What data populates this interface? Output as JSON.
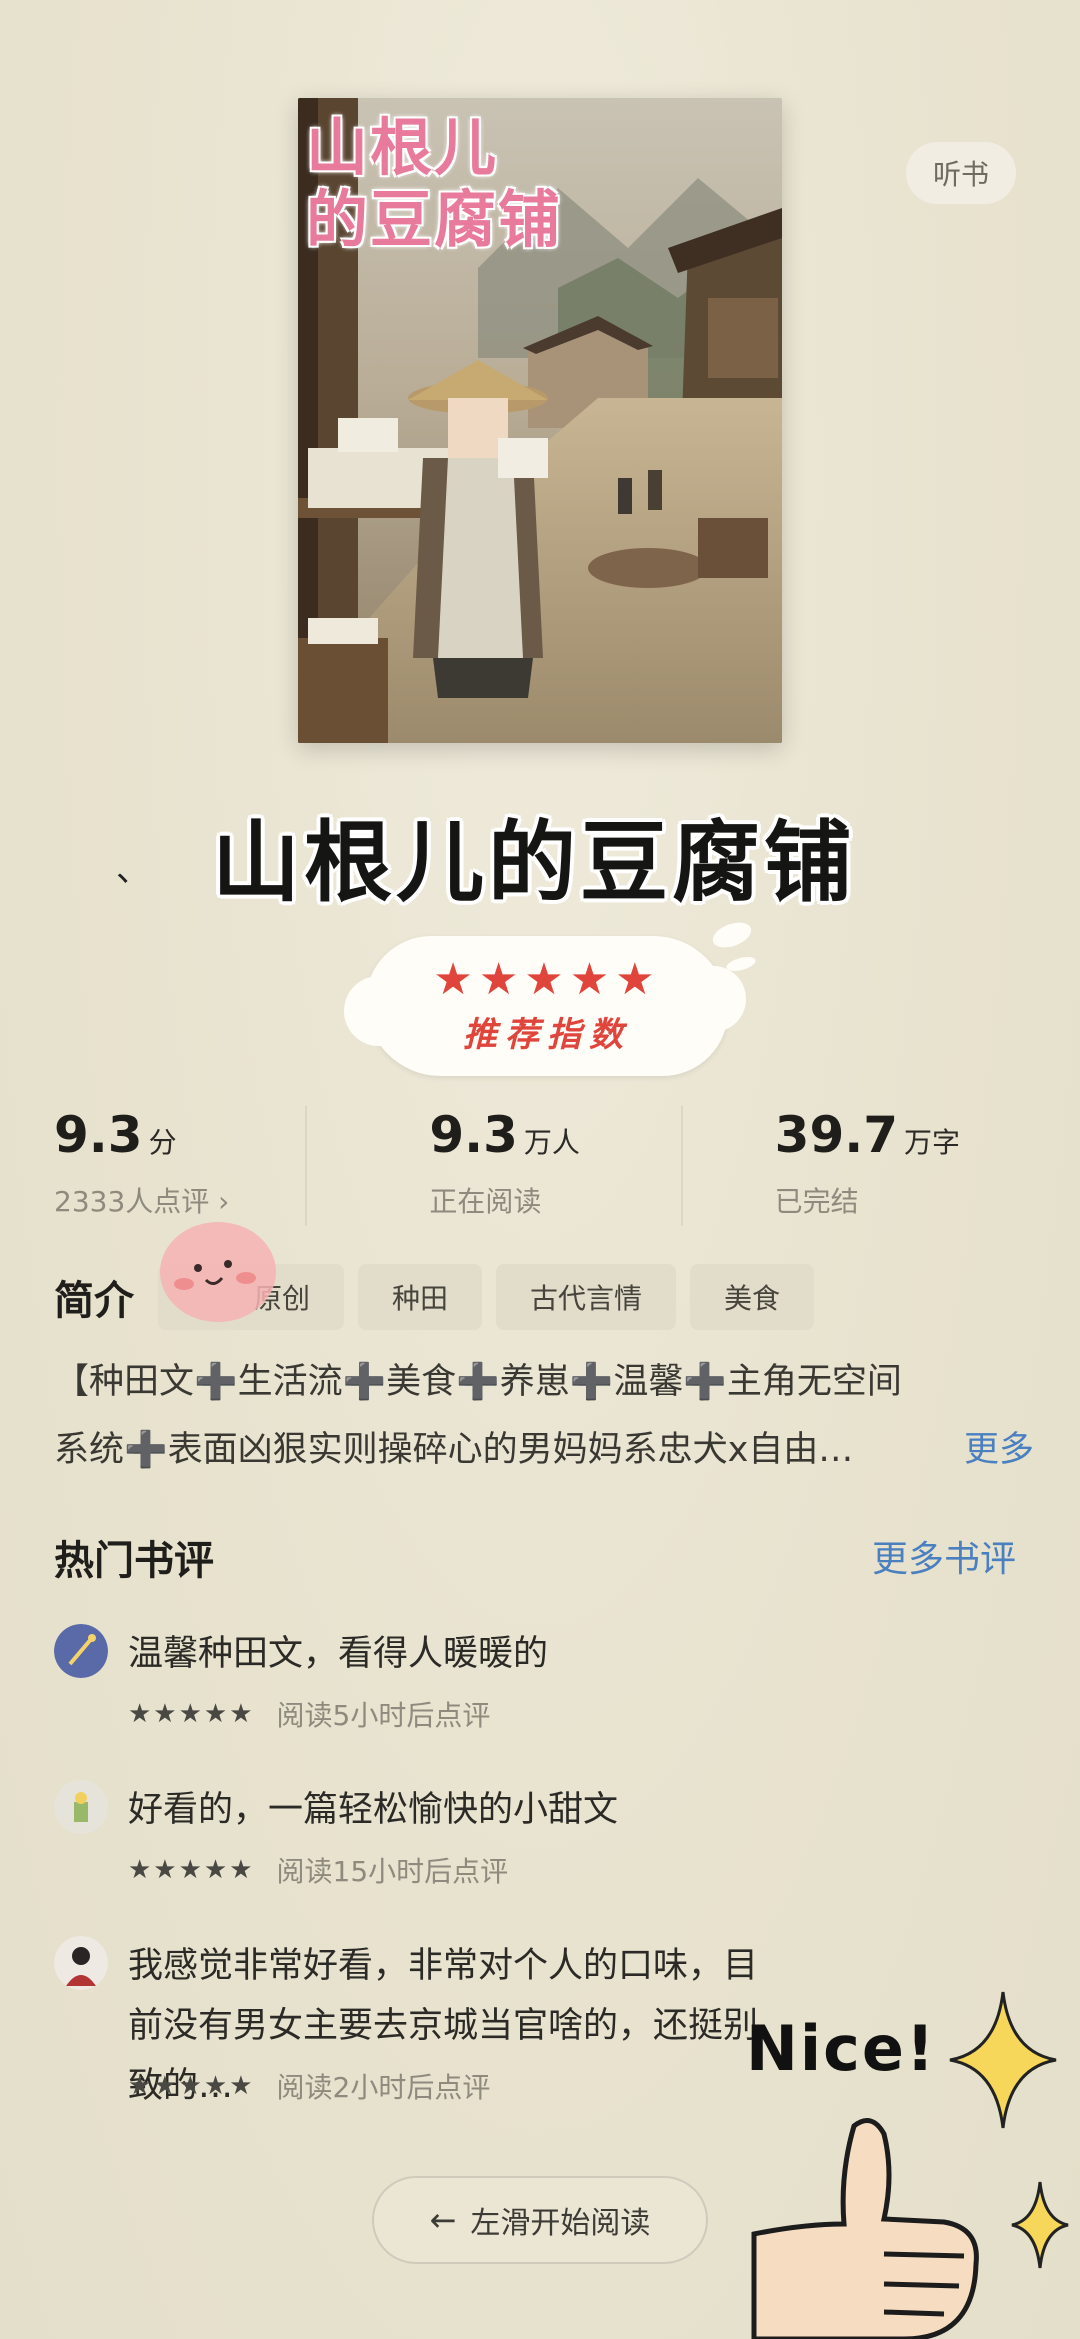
{
  "header": {
    "listen_label": "听书"
  },
  "cover": {
    "title_line1": "山根儿",
    "title_line2": "的豆腐铺"
  },
  "overlay": {
    "big_title": "山根儿的豆腐铺",
    "tick": "、",
    "rating_stars": "★★★★★",
    "rating_label": "推荐指数"
  },
  "stats": [
    {
      "value": "9.3",
      "unit": "分",
      "sub": "2333人点评 ›"
    },
    {
      "value": "9.3",
      "unit": "万人",
      "sub": "正在阅读"
    },
    {
      "value": "39.7",
      "unit": "万字",
      "sub": "已完结"
    }
  ],
  "intro": {
    "label": "简介",
    "tags": [
      "原创",
      "种田",
      "古代言情",
      "美食"
    ],
    "description": "【种田文➕生活流➕美食➕养崽➕温馨➕主角无空间系统➕表面凶狠实则操碎心的男妈妈系忠犬x自由…",
    "more_label": "更多"
  },
  "reviews": {
    "title": "热门书评",
    "more_label": "更多书评",
    "stars": "★★★★★",
    "items": [
      {
        "text": "温馨种田文，看得人暖暖的",
        "meta": "阅读5小时后点评"
      },
      {
        "text": "好看的，一篇轻松愉快的小甜文",
        "meta": "阅读15小时后点评"
      },
      {
        "text": "我感觉非常好看，非常对个人的口味，目前没有男女主要去京城当官啥的，还挺别致的…",
        "meta": "阅读2小时后点评"
      }
    ]
  },
  "footer": {
    "start_label": "左滑开始阅读",
    "arrow": "←"
  },
  "sticker": {
    "nice": "Nice!"
  },
  "colors": {
    "accent_blue": "#4a7fc0",
    "star_red": "#e0453c",
    "background": "#e9e4d1",
    "cover_title_pink": "#e87b9b"
  }
}
